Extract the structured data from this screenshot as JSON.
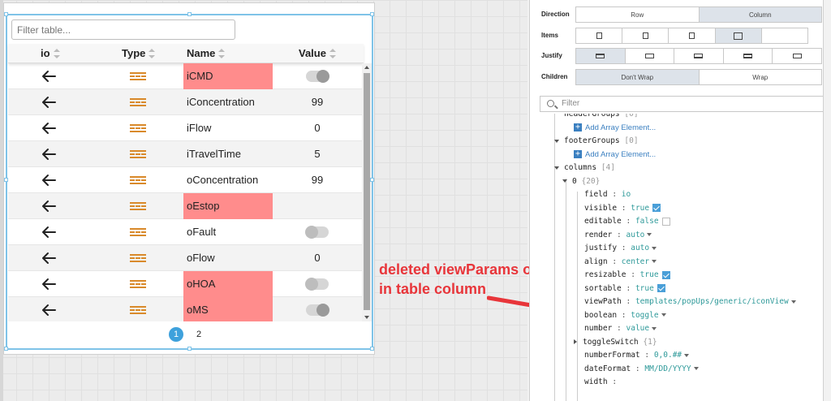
{
  "table": {
    "filter_placeholder": "Filter table...",
    "columns": [
      "io",
      "Type",
      "Name",
      "Value"
    ],
    "rows": [
      {
        "io": "arrow-left",
        "name": "iCMD",
        "value": "",
        "toggle": "on",
        "error": true
      },
      {
        "io": "arrow-left",
        "name": "iConcentration",
        "value": "99",
        "toggle": null,
        "error": false
      },
      {
        "io": "arrow-left",
        "name": "iFlow",
        "value": "0",
        "toggle": null,
        "error": false
      },
      {
        "io": "arrow-left",
        "name": "iTravelTime",
        "value": "5",
        "toggle": null,
        "error": false
      },
      {
        "io": "arrow-left",
        "name": "oConcentration",
        "value": "99",
        "toggle": null,
        "error": false
      },
      {
        "io": "arrow-left",
        "name": "oEstop",
        "value": "",
        "toggle": null,
        "error": true
      },
      {
        "io": "arrow-left",
        "name": "oFault",
        "value": "",
        "toggle": "off",
        "error": false
      },
      {
        "io": "arrow-left",
        "name": "oFlow",
        "value": "0",
        "toggle": null,
        "error": false
      },
      {
        "io": "arrow-left",
        "name": "oHOA",
        "value": "",
        "toggle": "off",
        "error": true
      },
      {
        "io": "arrow-left",
        "name": "oMS",
        "value": "",
        "toggle": "on",
        "error": true
      }
    ],
    "pages": [
      "1",
      "2"
    ],
    "active_page": "1"
  },
  "annotation": {
    "line1": "deleted viewParams object",
    "line2": "in table column",
    "color": "#e8353a"
  },
  "panel": {
    "direction": {
      "label": "Direction",
      "options": [
        "Row",
        "Column"
      ],
      "selected": "Column"
    },
    "items": {
      "label": "Items",
      "selected_index": 4
    },
    "justify": {
      "label": "Justify",
      "selected_index": 0
    },
    "children": {
      "label": "Children",
      "options": [
        "Don't Wrap",
        "Wrap"
      ],
      "selected": "Don't Wrap"
    },
    "filter_placeholder": "Filter",
    "tree": {
      "headerGroups": {
        "key": "headerGroups",
        "count": "[0]",
        "add": "Add Array Element..."
      },
      "footerGroups": {
        "key": "footerGroups",
        "count": "[0]",
        "add": "Add Array Element..."
      },
      "columns": {
        "key": "columns",
        "count": "[4]"
      },
      "col0": {
        "key": "0",
        "count": "{20}"
      },
      "props": [
        {
          "key": "field",
          "value": "io",
          "kind": "text"
        },
        {
          "key": "visible",
          "value": "true",
          "kind": "check-on"
        },
        {
          "key": "editable",
          "value": "false",
          "kind": "check-off"
        },
        {
          "key": "render",
          "value": "auto",
          "kind": "dropdown"
        },
        {
          "key": "justify",
          "value": "auto",
          "kind": "dropdown"
        },
        {
          "key": "align",
          "value": "center",
          "kind": "dropdown"
        },
        {
          "key": "resizable",
          "value": "true",
          "kind": "check-on"
        },
        {
          "key": "sortable",
          "value": "true",
          "kind": "check-on"
        },
        {
          "key": "viewPath",
          "value": "templates/popUps/generic/iconView",
          "kind": "dropdown"
        },
        {
          "key": "boolean",
          "value": "toggle",
          "kind": "dropdown"
        },
        {
          "key": "number",
          "value": "value",
          "kind": "dropdown"
        }
      ],
      "toggleSwitch": {
        "key": "toggleSwitch",
        "count": "{1}"
      },
      "props2": [
        {
          "key": "numberFormat",
          "value": "0,0.##",
          "kind": "dropdown"
        },
        {
          "key": "dateFormat",
          "value": "MM/DD/YYYY",
          "kind": "dropdown"
        },
        {
          "key": "width",
          "value": "",
          "kind": "text"
        }
      ]
    }
  },
  "colors": {
    "error_cell": "#ff8c8c",
    "type_icon": "#d98a2b",
    "selection": "#7fc3e8",
    "accent": "#3ea1dc",
    "tree_value": "#2f9a9a"
  }
}
